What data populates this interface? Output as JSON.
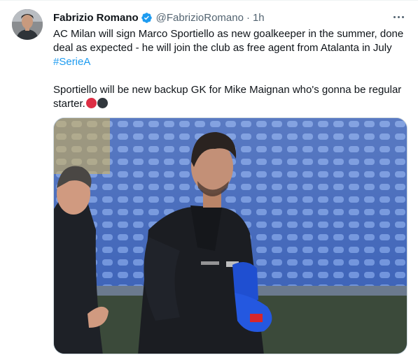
{
  "tweet": {
    "author_name": "Fabrizio Romano",
    "handle": "@FabrizioRomano",
    "separator": "·",
    "time": "1h",
    "text_line1": "AC Milan will sign Marco Sportiello as new goalkeeper in the summer, done deal as expected - he will join the club as free agent from Atalanta in July",
    "hashtag": "#SerieA",
    "text_line2": "Sportiello will be new backup GK for Mike Maignan who's gonna be regular starter.",
    "emoji": [
      "red-circle",
      "black-circle"
    ]
  },
  "icons": {
    "verified": "verified-badge-icon",
    "more": "more-options-icon"
  },
  "colors": {
    "link": "#1d9bf0",
    "verified": "#1d9bf0",
    "secondary_text": "#536471"
  },
  "media": {
    "shirt_text_left": "ASTRO",
    "shirt_text_right": "HAGEN"
  }
}
